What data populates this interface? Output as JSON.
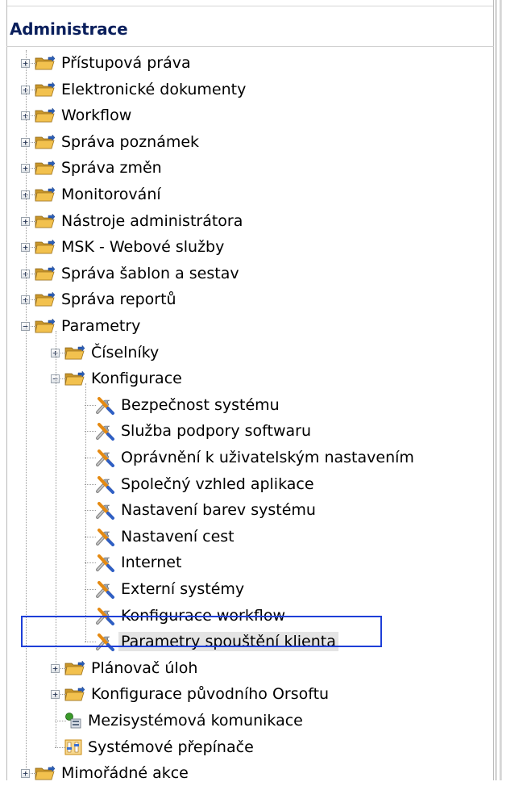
{
  "panel": {
    "title": "Administrace"
  },
  "tree": {
    "root_items": [
      {
        "label": "Přístupová práva",
        "icon": "folder-icon",
        "expander": "+"
      },
      {
        "label": "Elektronické dokumenty",
        "icon": "folder-icon",
        "expander": "+"
      },
      {
        "label": "Workflow",
        "icon": "folder-icon",
        "expander": "+"
      },
      {
        "label": "Správa poznámek",
        "icon": "folder-icon",
        "expander": "+"
      },
      {
        "label": "Správa změn",
        "icon": "folder-icon",
        "expander": "+"
      },
      {
        "label": "Monitorování",
        "icon": "folder-icon",
        "expander": "+"
      },
      {
        "label": "Nástroje administrátora",
        "icon": "folder-icon",
        "expander": "+"
      },
      {
        "label": "MSK - Webové služby",
        "icon": "folder-icon",
        "expander": "+"
      },
      {
        "label": "Správa šablon a sestav",
        "icon": "folder-icon",
        "expander": "+"
      },
      {
        "label": "Správa reportů",
        "icon": "folder-icon",
        "expander": "+"
      },
      {
        "label": "Parametry",
        "icon": "folder-icon",
        "expander": "−"
      }
    ],
    "parametry_children": [
      {
        "label": "Číselníky",
        "icon": "folder-icon",
        "expander": "+"
      },
      {
        "label": "Konfigurace",
        "icon": "folder-icon",
        "expander": "−"
      }
    ],
    "konfigurace_children": [
      {
        "label": "Bezpečnost systému",
        "icon": "wrench-screwdriver-icon"
      },
      {
        "label": "Služba podpory softwaru",
        "icon": "wrench-screwdriver-icon"
      },
      {
        "label": "Oprávnění k uživatelským nastavením",
        "icon": "wrench-screwdriver-icon"
      },
      {
        "label": "Společný vzhled aplikace",
        "icon": "wrench-screwdriver-icon"
      },
      {
        "label": "Nastavení barev systému",
        "icon": "wrench-screwdriver-icon"
      },
      {
        "label": "Nastavení cest",
        "icon": "wrench-screwdriver-icon"
      },
      {
        "label": "Internet",
        "icon": "wrench-screwdriver-icon"
      },
      {
        "label": "Externí systémy",
        "icon": "wrench-screwdriver-icon"
      },
      {
        "label": "Konfigurace workflow",
        "icon": "wrench-screwdriver-icon"
      },
      {
        "label": "Parametry spouštění klienta",
        "icon": "wrench-screwdriver-icon",
        "selected": true
      }
    ],
    "parametry_more": [
      {
        "label": "Plánovač úloh",
        "icon": "folder-icon",
        "expander": "+"
      },
      {
        "label": "Konfigurace původního Orsoftu",
        "icon": "folder-icon",
        "expander": "+"
      },
      {
        "label": "Mezisystémová komunikace",
        "icon": "network-icon"
      },
      {
        "label": "Systémové přepínače",
        "icon": "switches-icon"
      }
    ],
    "last_root": {
      "label": "Mimořádné akce",
      "icon": "folder-icon",
      "expander": "+"
    }
  },
  "colors": {
    "title": "#0a1f5c",
    "selection_border": "#1e3fd8",
    "selection_fill": "#e4e4e4",
    "folder": "#e8b43a"
  }
}
